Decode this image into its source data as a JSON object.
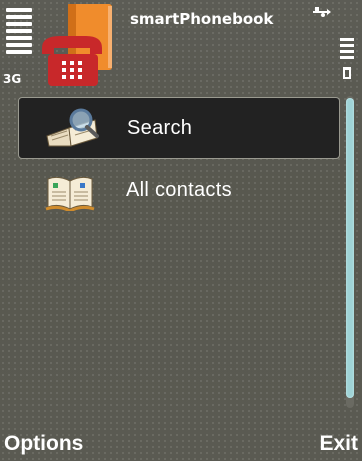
{
  "status": {
    "network": "3G",
    "app_title": "smartPhonebook",
    "icons": [
      "signal-strength-icon",
      "app-phonebook-icon",
      "usb-icon",
      "battery-icon"
    ]
  },
  "list": {
    "items": [
      {
        "label": "Search",
        "icon": "search-book-icon",
        "selected": true
      },
      {
        "label": "All contacts",
        "icon": "open-book-icon",
        "selected": false
      }
    ]
  },
  "softkeys": {
    "left": "Options",
    "right": "Exit"
  },
  "colors": {
    "background": "#5a5a52",
    "selection": "#222222",
    "scroll_thumb": "#9fd3d6",
    "book_orange": "#f08c2c",
    "phone_red": "#c8282a"
  }
}
